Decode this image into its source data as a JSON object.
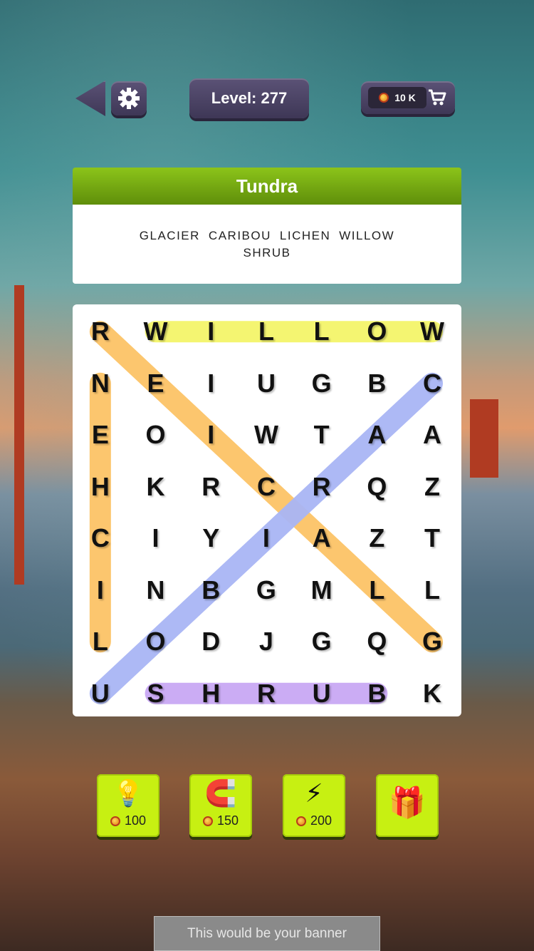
{
  "header": {
    "level_label": "Level: 277",
    "coins": "10 K"
  },
  "puzzle": {
    "category": "Tundra",
    "words_line1": [
      "GLACIER",
      "CARIBOU",
      "LICHEN",
      "WILLOW"
    ],
    "words_line2": [
      "SHRUB"
    ]
  },
  "grid": [
    [
      "R",
      "W",
      "I",
      "L",
      "L",
      "O",
      "W"
    ],
    [
      "N",
      "E",
      "I",
      "U",
      "G",
      "B",
      "C"
    ],
    [
      "E",
      "O",
      "I",
      "W",
      "T",
      "A",
      "A"
    ],
    [
      "H",
      "K",
      "R",
      "C",
      "R",
      "Q",
      "Z"
    ],
    [
      "C",
      "I",
      "Y",
      "I",
      "A",
      "Z",
      "T"
    ],
    [
      "I",
      "N",
      "B",
      "G",
      "M",
      "L",
      "L"
    ],
    [
      "L",
      "O",
      "D",
      "J",
      "G",
      "Q",
      "G"
    ],
    [
      "U",
      "S",
      "H",
      "R",
      "U",
      "B",
      "K"
    ]
  ],
  "found_words": [
    {
      "word": "WILLOW",
      "from": [
        0,
        1
      ],
      "to": [
        0,
        6
      ],
      "color": "#f4f56a"
    },
    {
      "word": "LICHEN",
      "from": [
        6,
        0
      ],
      "to": [
        1,
        0
      ],
      "color": "#fcc467"
    },
    {
      "word": "GLACIER",
      "from": [
        6,
        6
      ],
      "to": [
        0,
        0
      ],
      "color": "#fcc467"
    },
    {
      "word": "CARIBOU",
      "from": [
        1,
        6
      ],
      "to": [
        7,
        0
      ],
      "color": "#a9b6f5"
    },
    {
      "word": "SHRUB",
      "from": [
        7,
        1
      ],
      "to": [
        7,
        5
      ],
      "color": "#c9a8f4"
    }
  ],
  "powerups": [
    {
      "name": "hint",
      "icon": "💡",
      "cost": "100"
    },
    {
      "name": "magnet",
      "icon": "🧲",
      "cost": "150"
    },
    {
      "name": "lightning",
      "icon": "⚡",
      "cost": "200"
    },
    {
      "name": "video-gift",
      "icon": "🎁",
      "cost": ""
    }
  ],
  "banner_text": "This would be your banner"
}
